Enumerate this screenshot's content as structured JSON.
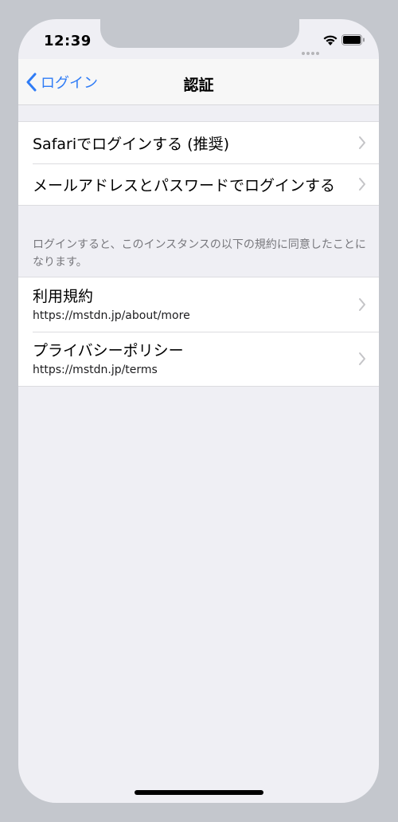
{
  "status": {
    "time": "12:39"
  },
  "nav": {
    "back_label": "ログイン",
    "title": "認証"
  },
  "login_options": [
    {
      "label": "Safariでログインする (推奨)"
    },
    {
      "label": "メールアドレスとパスワードでログインする"
    }
  ],
  "terms_note": "ログインすると、このインスタンスの以下の規約に同意したことになります。",
  "policies": [
    {
      "title": "利用規約",
      "url": "https://mstdn.jp/about/more"
    },
    {
      "title": "プライバシーポリシー",
      "url": "https://mstdn.jp/terms"
    }
  ],
  "colors": {
    "accent": "#2f7cf6",
    "background": "#efeff4"
  }
}
